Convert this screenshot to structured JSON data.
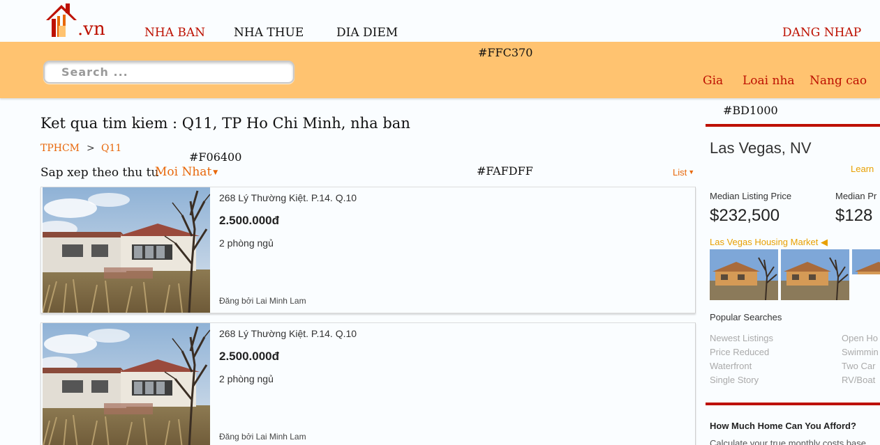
{
  "header": {
    "logo_text": ".vn",
    "nav": [
      {
        "label": "NHA BAN"
      },
      {
        "label": "NHA THUE"
      },
      {
        "label": "DIA DIEM"
      }
    ],
    "login_label": "DANG NHAP"
  },
  "band": {
    "color_note": "#FFC370",
    "search_placeholder": "Search ...",
    "filters": [
      "Gia",
      "Loai nha",
      "Nang cao"
    ]
  },
  "color_notes": {
    "red": "#BD1000",
    "orange": "#F06400",
    "background": "#FAFDFF"
  },
  "colors": {
    "brand_red": "#BD1000",
    "accent_orange": "#F06400",
    "band": "#FFC370",
    "background": "#FAFDFF"
  },
  "results": {
    "title": "Ket qua tim kiem : Q11, TP Ho Chi Minh, nha ban",
    "breadcrumb": [
      "TPHCM",
      ">",
      "Q11"
    ],
    "sort_label": "Sap xep theo thu tu",
    "sort_value": "Moi Nhat",
    "view_mode": "List",
    "listings": [
      {
        "address": "268 Lý Thường Kiệt. P.14. Q.10",
        "price": "2.500.000đ",
        "bedrooms": "2 phòng ngủ",
        "posted_by": "Đăng bởi Lai Minh Lam"
      },
      {
        "address": "268 Lý Thường Kiệt. P.14. Q.10",
        "price": "2.500.000đ",
        "bedrooms": "2 phòng ngủ",
        "posted_by": "Đăng bởi Lai Minh Lam"
      }
    ]
  },
  "sidebar": {
    "city": "Las Vegas, NV",
    "learn_more": "Learn",
    "stats": [
      {
        "label": "Median Listing Price",
        "value": "$232,500"
      },
      {
        "label": "Median Pr",
        "value": "$128"
      }
    ],
    "market_link": "Las Vegas Housing Market",
    "popular_title": "Popular Searches",
    "popular_left": [
      "Newest Listings",
      "Price Reduced",
      "Waterfront",
      "Single Story"
    ],
    "popular_right": [
      "Open Ho",
      "Swimmin",
      "Two Car",
      "RV/Boat"
    ],
    "afford_title": "How Much Home Can You Afford?",
    "afford_sub": "Calculate your true monthly costs base"
  }
}
